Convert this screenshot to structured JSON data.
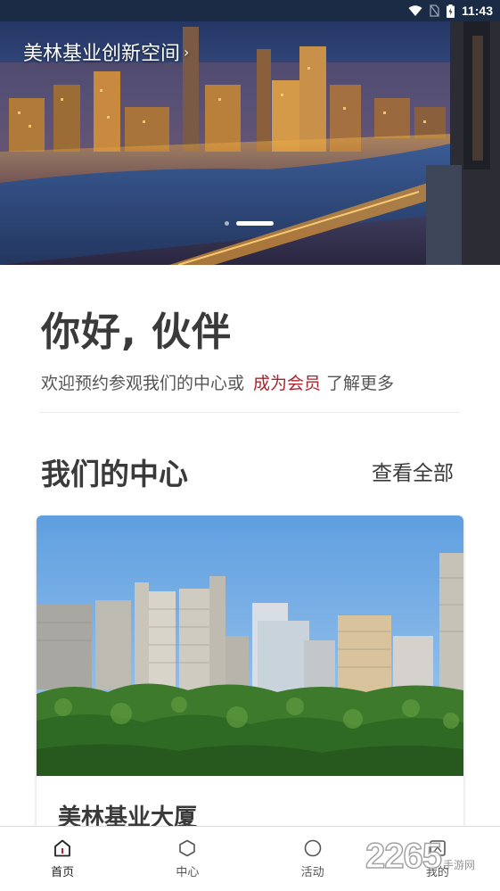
{
  "status_bar": {
    "time": "11:43"
  },
  "banner": {
    "title": "美林基业创新空间",
    "chevron": "›",
    "slide_count": 2,
    "active_slide": 2
  },
  "greeting": {
    "title": "你好, 伙伴",
    "subtitle_prefix": "欢迎预约参观我们的中心或",
    "member_link": "成为会员",
    "subtitle_suffix": "了解更多"
  },
  "centers": {
    "title": "我们的中心",
    "view_all": "查看全部",
    "card": {
      "name": "美林基业大厦"
    }
  },
  "bottom_nav": {
    "items": [
      {
        "label": "首页",
        "icon": "home-icon",
        "active": true
      },
      {
        "label": "中心",
        "icon": "hexagon-icon",
        "active": false
      },
      {
        "label": "活动",
        "icon": "circle-icon",
        "active": false
      },
      {
        "label": "我的",
        "icon": "profile-icon",
        "active": false
      }
    ]
  },
  "watermark": {
    "number": "2265",
    "text": "手游网"
  },
  "colors": {
    "accent": "#a8242e",
    "text": "#3a3a3a",
    "status_bar": "#1b2a45"
  }
}
